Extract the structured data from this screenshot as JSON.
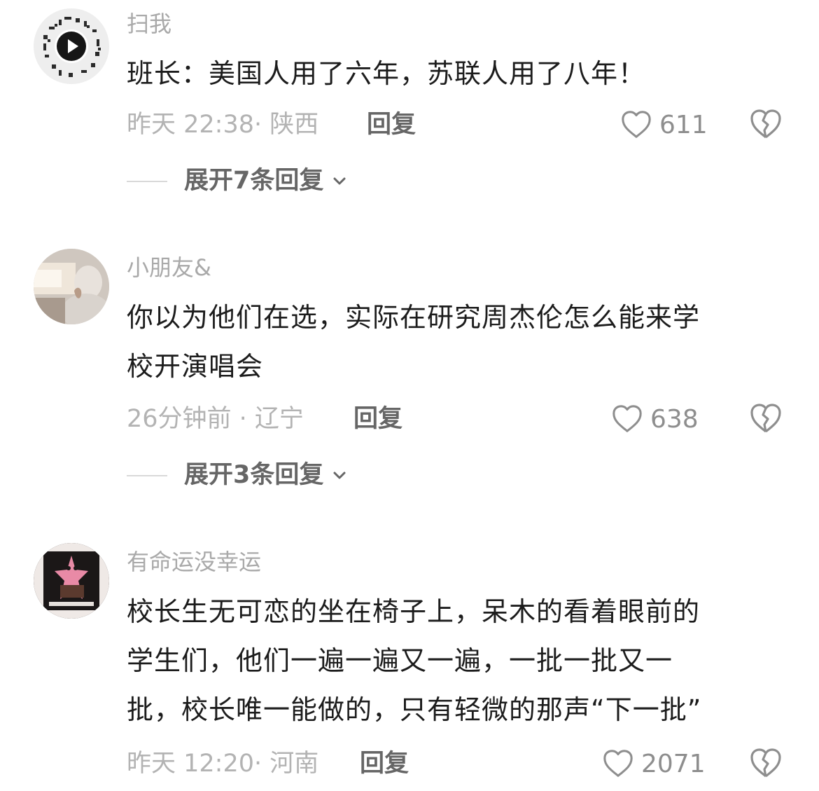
{
  "comments": [
    {
      "username": "扫我",
      "avatar_icon": "qr-code-play-icon",
      "text": "班长：美国人用了六年，苏联人用了八年！",
      "time_location": "昨天 22:38· 陕西",
      "reply_label": "回复",
      "likes": "611",
      "expand_label": "展开7条回复"
    },
    {
      "username": "小朋友&",
      "avatar_icon": "profile-photo",
      "text": "你以为他们在选，实际在研究周杰伦怎么能来学\n校开演唱会",
      "time_location": "26分钟前 · 辽宁",
      "reply_label": "回复",
      "likes": "638",
      "expand_label": "展开3条回复"
    },
    {
      "username": "有命运没幸运",
      "avatar_icon": "cartoon-star-avatar",
      "text": "校长生无可恋的坐在椅子上，呆木的看着眼前的\n学生们，他们一遍一遍又一遍，一批一批又一\n批，校长唯一能做的，只有轻微的那声“下一批”",
      "time_location": "昨天 12:20· 河南",
      "reply_label": "回复",
      "likes": "2071"
    }
  ],
  "icons": {
    "like": "heart-outline-icon",
    "dislike": "broken-heart-icon",
    "expand": "chevron-down-icon"
  },
  "colors": {
    "username": "#a9a9a9",
    "body": "#1c1c1c",
    "meta": "#b3b3b3",
    "action": "#666666"
  }
}
